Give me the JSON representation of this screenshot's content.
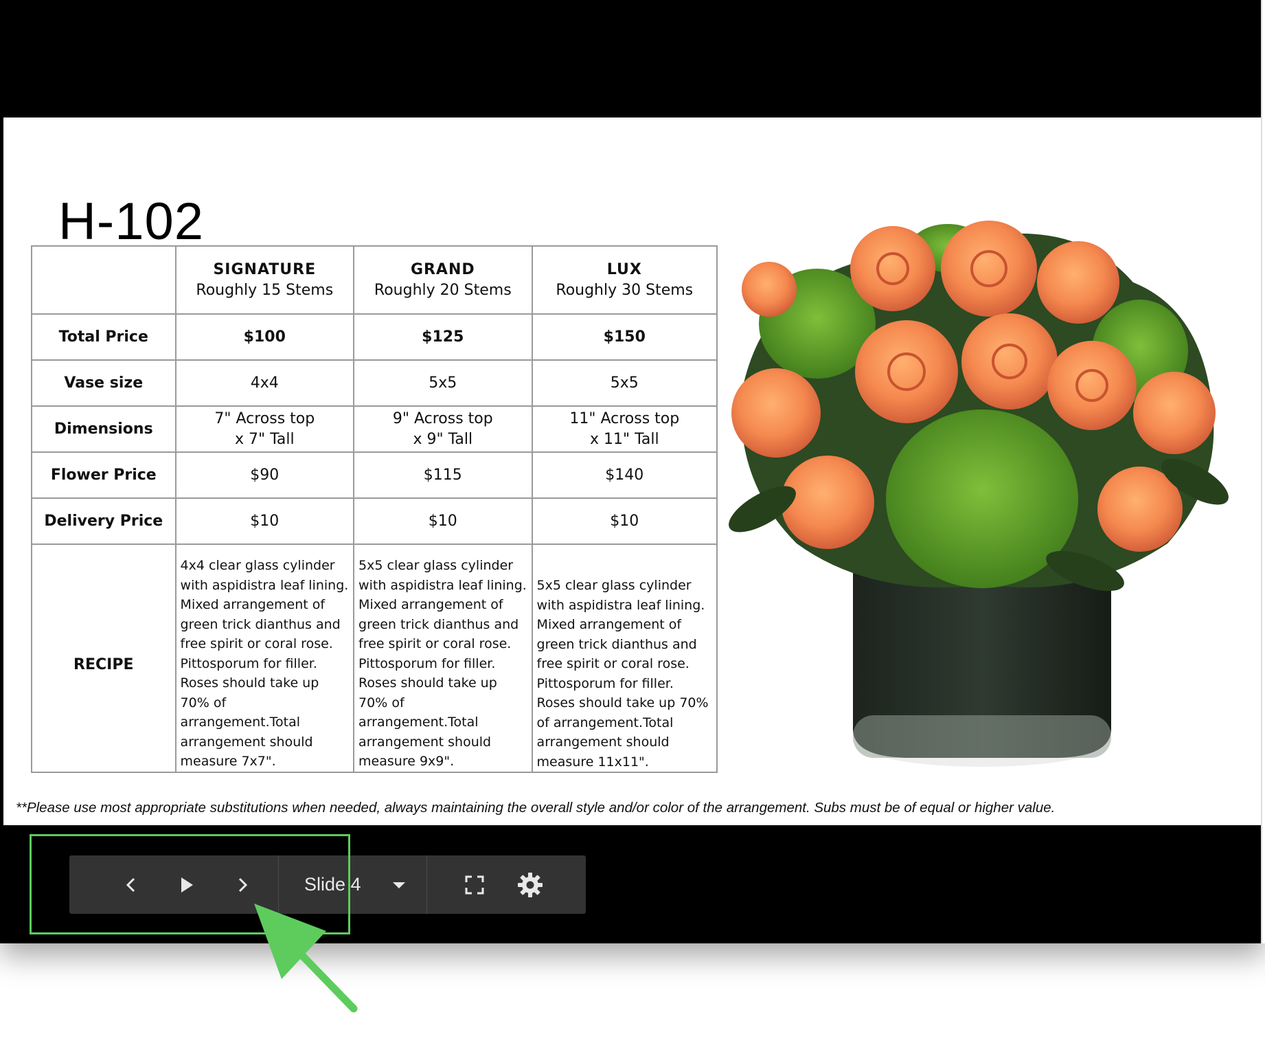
{
  "slide": {
    "title": "H-102",
    "table": {
      "tiers": [
        {
          "name": "SIGNATURE",
          "stems": "Roughly 15 Stems"
        },
        {
          "name": "GRAND",
          "stems": "Roughly 20 Stems"
        },
        {
          "name": "LUX",
          "stems": "Roughly 30 Stems"
        }
      ],
      "rows": {
        "total_price": {
          "label": "Total Price",
          "values": [
            "$100",
            "$125",
            "$150"
          ]
        },
        "vase_size": {
          "label": "Vase size",
          "values": [
            "4x4",
            "5x5",
            "5x5"
          ]
        },
        "dimensions": {
          "label": "Dimensions",
          "line1": [
            "7\" Across top",
            "9\" Across top",
            "11\" Across top"
          ],
          "line2": [
            "x 7\" Tall",
            "x 9\" Tall",
            "x 11\" Tall"
          ]
        },
        "flower_price": {
          "label": "Flower Price",
          "values": [
            "$90",
            "$115",
            "$140"
          ]
        },
        "delivery_price": {
          "label": "Delivery Price",
          "values": [
            "$10",
            "$10",
            "$10"
          ]
        },
        "recipe": {
          "label": "RECIPE",
          "values": [
            "4x4 clear glass cylinder with aspidistra leaf lining. Mixed arrangement of green trick dianthus and free spirit or coral rose. Pittosporum for filler. Roses should take up 70% of arrangement.Total arrangement should measure 7x7\".",
            "5x5 clear glass cylinder with aspidistra leaf lining. Mixed arrangement of green trick dianthus and free spirit or coral rose. Pittosporum for filler. Roses should take up 70% of arrangement.Total arrangement should measure 9x9\".",
            "5x5 clear glass cylinder with aspidistra leaf lining. Mixed arrangement of green trick dianthus and free spirit or coral rose. Pittosporum for filler. Roses should take up 70% of arrangement.Total arrangement should measure 11x11\"."
          ]
        }
      }
    },
    "note": "**Please use most appropriate substitutions when needed, always maintaining the overall style and/or color of the arrangement. Subs must be of equal or higher value."
  },
  "toolbar": {
    "slide_label": "Slide 4",
    "icons": [
      "chevron-left-icon",
      "play-icon",
      "chevron-right-icon",
      "dropdown-arrow-icon",
      "fullscreen-icon",
      "gear-icon"
    ]
  },
  "colors": {
    "frame": "#000000",
    "toolbar": "#333333",
    "highlight": "#5dcc5d",
    "rose": "#f5894f",
    "foliage": "#4f8f1f"
  }
}
